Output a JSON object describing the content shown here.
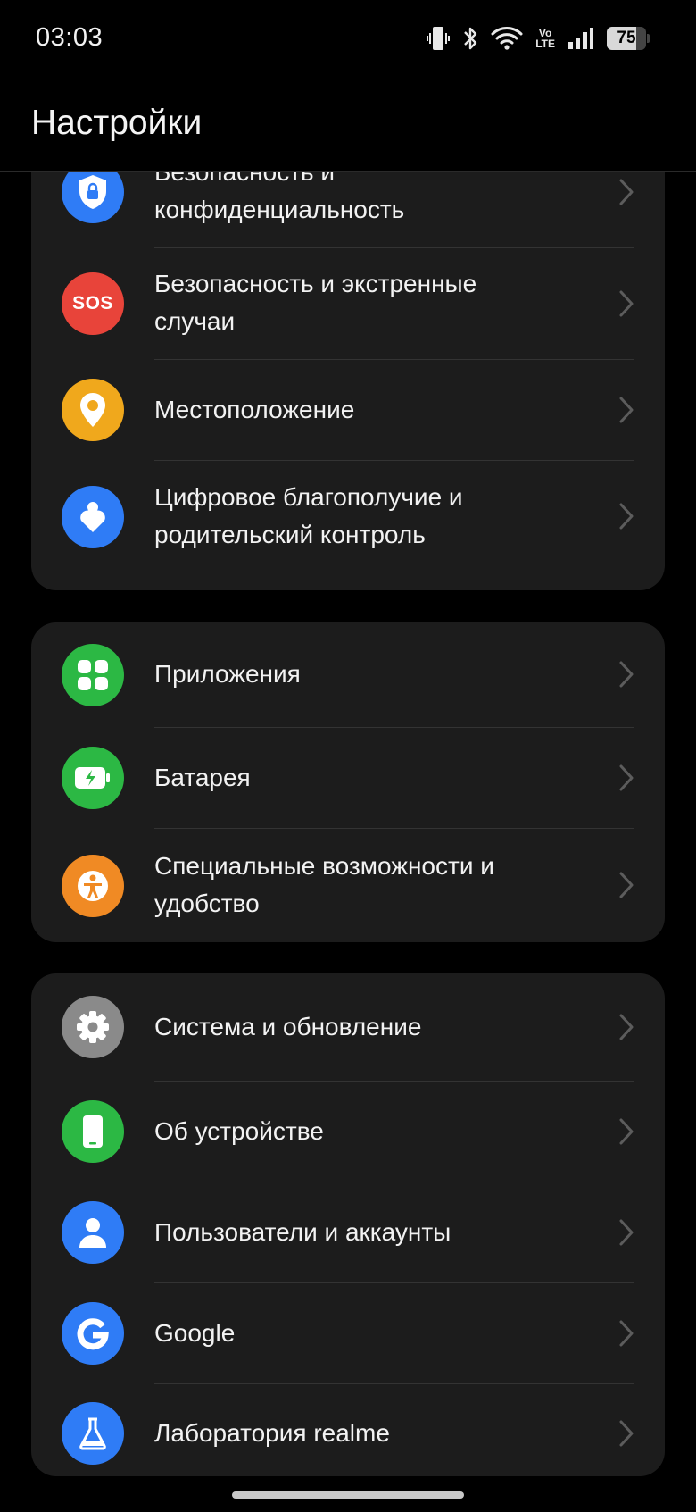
{
  "status_bar": {
    "time": "03:03",
    "volte_label_top": "Vo",
    "volte_label_bottom": "LTE",
    "battery_level": "75",
    "battery_fraction": 0.75
  },
  "header": {
    "title": "Настройки"
  },
  "groups": [
    {
      "items": [
        {
          "label": "Безопасность и конфиденциальность",
          "icon": "shield-lock-icon",
          "color": "#2f7cf6"
        },
        {
          "label": "Безопасность и экстренные случаи",
          "icon": "sos-icon",
          "icon_text": "SOS",
          "color": "#e8443a"
        },
        {
          "label": "Местоположение",
          "icon": "location-pin-icon",
          "color": "#f0a81c"
        },
        {
          "label": "Цифровое благополучие и родительский контроль",
          "icon": "heart-person-icon",
          "color": "#2f7cf6"
        }
      ]
    },
    {
      "items": [
        {
          "label": "Приложения",
          "icon": "apps-grid-icon",
          "color": "#2cb844"
        },
        {
          "label": "Батарея",
          "icon": "battery-charge-icon",
          "color": "#2cb844"
        },
        {
          "label": "Специальные возможности и удобство",
          "icon": "accessibility-icon",
          "color": "#f08a24"
        }
      ]
    },
    {
      "items": [
        {
          "label": "Система и обновление",
          "icon": "gear-icon",
          "color": "#8a8a8a"
        },
        {
          "label": "Об устройстве",
          "icon": "phone-icon",
          "color": "#2cb844"
        },
        {
          "label": "Пользователи и аккаунты",
          "icon": "user-icon",
          "color": "#2f7cf6"
        },
        {
          "label": "Google",
          "icon": "google-icon",
          "color": "#2f7cf6"
        },
        {
          "label": "Лаборатория realme",
          "icon": "flask-icon",
          "color": "#2f7cf6"
        }
      ]
    }
  ]
}
